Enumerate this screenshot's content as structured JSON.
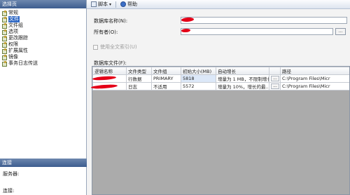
{
  "sidebar": {
    "header": "选择页",
    "items": [
      {
        "label": "常规",
        "selected": false
      },
      {
        "label": "文件",
        "selected": true
      },
      {
        "label": "文件组",
        "selected": false
      },
      {
        "label": "选项",
        "selected": false
      },
      {
        "label": "更改跟踪",
        "selected": false
      },
      {
        "label": "权限",
        "selected": false
      },
      {
        "label": "扩展属性",
        "selected": false
      },
      {
        "label": "镜像",
        "selected": false
      },
      {
        "label": "事务日志传送",
        "selected": false
      }
    ],
    "connection_header": "连接",
    "server_label": "服务器:",
    "connection_label": "连接:"
  },
  "toolbar": {
    "script_label": "脚本",
    "script_dropdown": "▾",
    "help_label": "帮助"
  },
  "form": {
    "db_name_label": "数据库名称(N):",
    "owner_label": "所有者(O):",
    "browse_label": "...",
    "fulltext_label": "使用全文索引(U)",
    "files_label": "数据库文件(F):"
  },
  "grid": {
    "headers": [
      "逻辑名称",
      "文件类型",
      "文件组",
      "初始大小(MB)",
      "自动增长",
      "",
      "路径"
    ],
    "rows": [
      [
        "",
        "行数据",
        "PRIMARY",
        "5818",
        "增量为 1 MB，不限制增长",
        "...",
        "C:\\Program Files\\Micr"
      ],
      [
        "",
        "日志",
        "不适用",
        "5572",
        "增量为 10%，增长的最...",
        "...",
        "C:\\Program Files\\Micr"
      ]
    ]
  }
}
